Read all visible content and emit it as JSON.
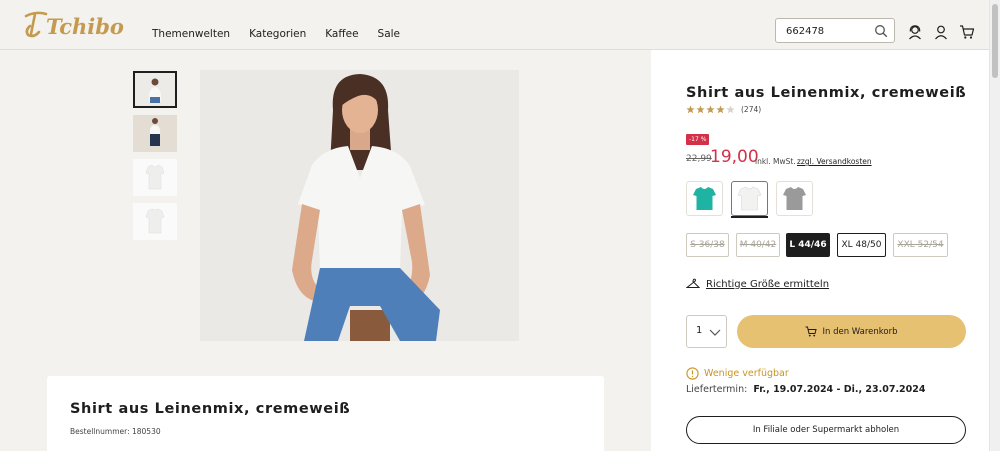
{
  "header": {
    "logo_text": "Tchibo",
    "nav": [
      "Themenwelten",
      "Kategorien",
      "Kaffee",
      "Sale"
    ],
    "search": {
      "value": "662478",
      "icon": "search-icon"
    },
    "icons": [
      "customer-service-icon",
      "account-icon",
      "cart-icon"
    ]
  },
  "gallery": {
    "thumbnails": [
      "model-front-photo",
      "model-full-photo",
      "shirt-front-photo",
      "shirt-back-photo"
    ],
    "active_index": 0
  },
  "product": {
    "title": "Shirt aus Leinenmix, cremeweiß",
    "rating": {
      "stars": 4,
      "max": 5,
      "count": "(274)"
    },
    "discount_badge": "-17 %",
    "old_price": "22,99",
    "price": "19,00",
    "vat": "inkl. MwSt.",
    "shipping": "zzgl. Versandkosten",
    "colors": [
      {
        "name": "tuerkis",
        "hex": "#1fb3a4"
      },
      {
        "name": "cremeweiss",
        "hex": "#f2f2f0",
        "selected": true
      },
      {
        "name": "grau",
        "hex": "#9a9a9a"
      }
    ],
    "sizes": [
      {
        "label": "S 36/38",
        "state": "unavailable"
      },
      {
        "label": "M 40/42",
        "state": "unavailable"
      },
      {
        "label": "L 44/46",
        "state": "selected"
      },
      {
        "label": "XL 48/50",
        "state": "available"
      },
      {
        "label": "XXL 52/54",
        "state": "unavailable"
      }
    ],
    "size_help": "Richtige Größe ermitteln",
    "quantity": "1",
    "add_to_cart": "In den Warenkorb",
    "availability": "Wenige verfügbar",
    "delivery_label": "Liefertermin:",
    "delivery_value": "Fr., 19.07.2024 - Di., 23.07.2024",
    "pickup": "In Filiale oder Supermarkt abholen"
  },
  "description": {
    "title": "Shirt aus Leinenmix, cremeweiß",
    "order_number": "Bestellnummer: 180530"
  },
  "colors": {
    "accent": "#e6c172",
    "sale": "#d3304a",
    "logo": "#c49a4f",
    "background": "#f4f2ee"
  }
}
